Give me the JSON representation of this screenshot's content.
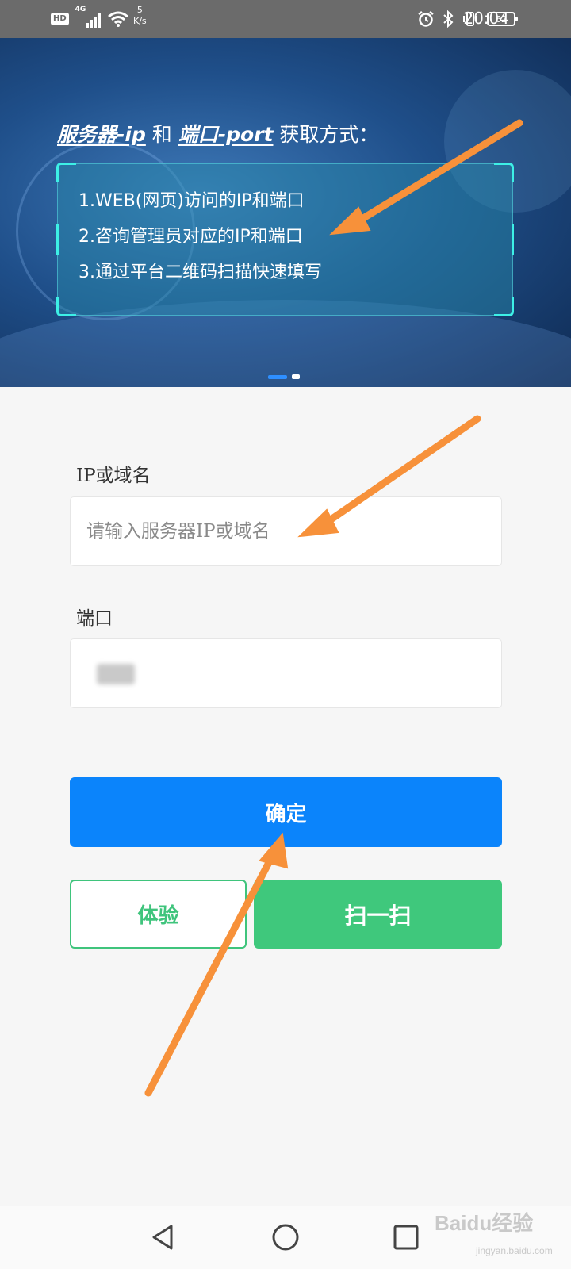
{
  "status_bar": {
    "hd": "HD",
    "network": "4G",
    "speed_value": "5",
    "speed_unit": "K/s",
    "battery": "62",
    "time": "20:04"
  },
  "banner": {
    "heading_part1": "服务器-ip",
    "heading_and": " 和 ",
    "heading_part2": "端口-port",
    "heading_suffix": " 获取方式：",
    "lines": [
      "1.WEB(网页)访问的IP和端口",
      "2.咨询管理员对应的IP和端口",
      "3.通过平台二维码扫描快速填写"
    ],
    "slide_index": 1,
    "slide_count": 2
  },
  "form": {
    "ip_label": "IP或域名",
    "ip_placeholder": "请输入服务器IP或域名",
    "ip_value": "",
    "port_label": "端口",
    "port_value": ""
  },
  "buttons": {
    "confirm": "确定",
    "trial": "体验",
    "scan": "扫一扫"
  },
  "watermark": {
    "text": "Baidu经验",
    "sub": "jingyan.baidu.com"
  },
  "colors": {
    "status_bar": "#6b6b6b",
    "primary_blue": "#0b84fb",
    "green": "#3fc87c",
    "annotation_arrow": "#f7913a",
    "banner_accent": "#3df0e6"
  }
}
